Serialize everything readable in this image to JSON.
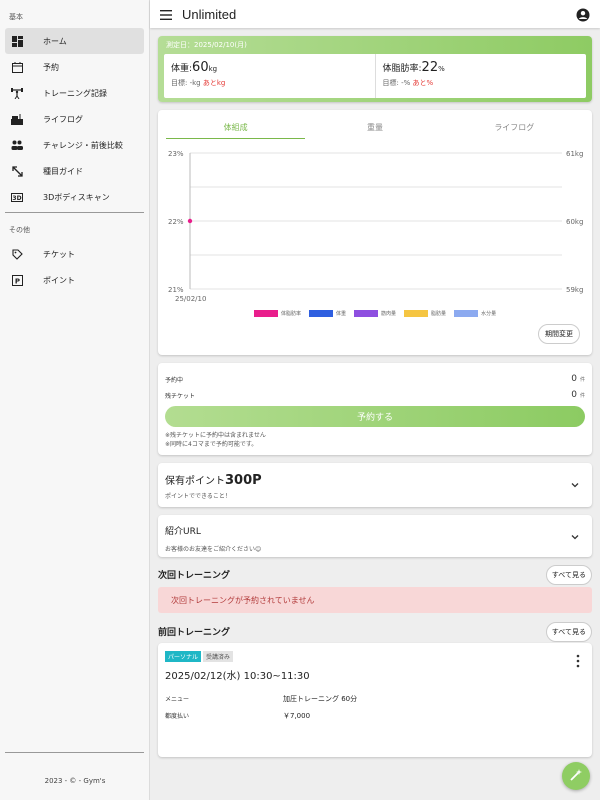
{
  "app": {
    "title": "Unlimited"
  },
  "sidebar": {
    "section_basic": "基本",
    "items": [
      {
        "label": "ホーム",
        "icon": "dashboard-icon"
      },
      {
        "label": "予約",
        "icon": "calendar-edit-icon"
      },
      {
        "label": "トレーニング記録",
        "icon": "weightlifting-icon"
      },
      {
        "label": "ライフログ",
        "icon": "lifelog-icon"
      },
      {
        "label": "チャレンジ・前後比較",
        "icon": "people-icon"
      },
      {
        "label": "種目ガイド",
        "icon": "expand-arrows-icon"
      },
      {
        "label": "3Dボディスキャン",
        "icon": "3d-icon"
      }
    ],
    "section_other": "その他",
    "other_items": [
      {
        "label": "チケット",
        "icon": "ticket-icon"
      },
      {
        "label": "ポイント",
        "icon": "parking-icon"
      }
    ],
    "footer": "2023 - © - Gym's"
  },
  "measurement": {
    "date": "測定日：2025/02/10(月)",
    "weight": {
      "label": "体重:",
      "value": "60",
      "unit": "kg",
      "target_prefix": "目標: -kg ",
      "target_remaining": "あとkg"
    },
    "body_fat": {
      "label": "体脂肪率:",
      "value": "22",
      "unit": "%",
      "target_prefix": "目標: -% ",
      "target_remaining": "あと%"
    }
  },
  "chart_tabs": [
    "体組成",
    "重量",
    "ライフログ"
  ],
  "chart_data": {
    "type": "line",
    "x": [
      "25/02/10"
    ],
    "series": [
      {
        "name": "体脂肪率",
        "color": "#e91e8c",
        "values": [
          22
        ]
      },
      {
        "name": "体重",
        "color": "#2f5fe0",
        "values": [
          60
        ]
      },
      {
        "name": "筋肉量",
        "color": "#8e4fe0",
        "values": [
          null
        ]
      },
      {
        "name": "脂肪量",
        "color": "#f5c542",
        "values": [
          null
        ]
      },
      {
        "name": "水分量",
        "color": "#8caaf0",
        "values": [
          null
        ]
      }
    ],
    "y_left": {
      "ticks": [
        "23%",
        "22%",
        "21%"
      ],
      "range": [
        21,
        23
      ]
    },
    "y_right": {
      "ticks": [
        "61kg",
        "60kg",
        "59kg"
      ],
      "range": [
        59,
        61
      ]
    },
    "grid": true,
    "legend": "bottom"
  },
  "period_button": "期間変更",
  "reservation": {
    "reserved_label": "予約中",
    "reserved_count": "0",
    "tickets_label": "残チケット",
    "tickets_count": "0",
    "unit": "件",
    "button": "予約する",
    "note1": "※残チケットに予約中は含まれません",
    "note2": "※同時に4コマまで予約可能です。"
  },
  "points": {
    "label": "保有ポイント",
    "value": "300P",
    "desc": "ポイントでできること！"
  },
  "referral": {
    "label": "紹介URL",
    "desc": "お客様のお友達をご紹介ください😊"
  },
  "next_training": {
    "title": "次回トレーニング",
    "see_all": "すべて見る",
    "empty": "次回トレーニングが予約されていません"
  },
  "prev_training": {
    "title": "前回トレーニング",
    "see_all": "すべて見る",
    "badge_type": "パーソナル",
    "badge_status": "受講済み",
    "datetime": "2025/02/12(水) 10:30~11:30",
    "menu_label": "メニュー",
    "menu_value": "加圧トレーニング 60分",
    "pay_label": "都度払い",
    "pay_value": "￥7,000"
  }
}
